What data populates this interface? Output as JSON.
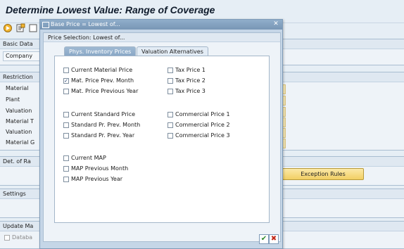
{
  "app": {
    "title": "Determine Lowest Value: Range of Coverage"
  },
  "sections": {
    "basic_data": "Basic Data",
    "basic_company": "Company",
    "restriction": "Restriction",
    "restriction_rows": [
      "Material",
      "Plant",
      "Valuation",
      "Material T",
      "Valuation",
      "Material G"
    ],
    "det": "Det. of Ra",
    "exception_rules": "Exception Rules",
    "settings": "Settings",
    "update": "Update Ma",
    "update_check": "Databa"
  },
  "dialog": {
    "title": "Base Price = Lowest of...",
    "group": "Price Selection: Lowest of...",
    "tabs": [
      "Phys. Inventory Prices",
      "Valuation Alternatives"
    ],
    "left_col1": [
      {
        "label": "Current Material Price",
        "checked": false
      },
      {
        "label": "Mat. Price Prev. Month",
        "checked": true
      },
      {
        "label": "Mat. Price Previous Year",
        "checked": false
      }
    ],
    "left_col2": [
      {
        "label": "Current Standard Price",
        "checked": false
      },
      {
        "label": "Standard Pr. Prev. Month",
        "checked": false
      },
      {
        "label": "Standard Pr. Prev. Year",
        "checked": false
      }
    ],
    "left_col3": [
      {
        "label": "Current MAP",
        "checked": false
      },
      {
        "label": "MAP Previous Month",
        "checked": false
      },
      {
        "label": "MAP Previous Year",
        "checked": false
      }
    ],
    "right_col1": [
      {
        "label": "Tax Price 1",
        "checked": false
      },
      {
        "label": "Tax Price 2",
        "checked": false
      },
      {
        "label": "Tax Price 3",
        "checked": false
      }
    ],
    "right_col2": [
      {
        "label": "Commercial Price 1",
        "checked": false
      },
      {
        "label": "Commercial Price 2",
        "checked": false
      },
      {
        "label": "Commercial Price 3",
        "checked": false
      }
    ],
    "ok_icon": "checkmark-icon",
    "cancel_icon": "cancel-x-icon"
  }
}
